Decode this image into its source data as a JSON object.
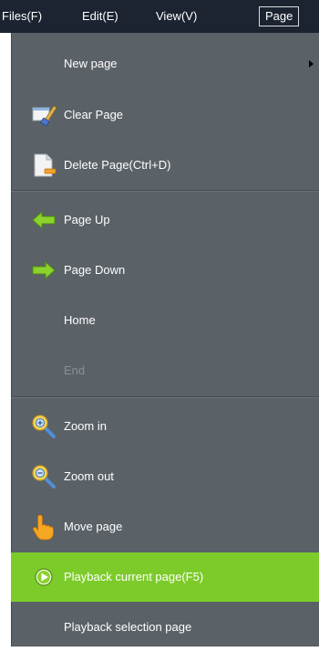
{
  "menubar": {
    "items": [
      {
        "label": "Files(F)"
      },
      {
        "label": "Edit(E)"
      },
      {
        "label": "View(V)"
      },
      {
        "label": "Page",
        "active": true
      }
    ]
  },
  "dropdown": {
    "items": [
      {
        "label": "New page",
        "icon": null,
        "submenu": true
      },
      {
        "label": "Clear Page",
        "icon": "broom-icon"
      },
      {
        "label": "Delete Page(Ctrl+D)",
        "icon": "document-delete-icon"
      },
      {
        "label": "Page Up",
        "icon": "arrow-left-green-icon"
      },
      {
        "label": "Page Down",
        "icon": "arrow-right-green-icon"
      },
      {
        "label": "Home",
        "icon": null
      },
      {
        "label": "End",
        "icon": null,
        "disabled": true
      },
      {
        "label": "Zoom in",
        "icon": "zoom-in-icon"
      },
      {
        "label": "Zoom out",
        "icon": "zoom-out-icon"
      },
      {
        "label": "Move page",
        "icon": "hand-pointer-icon"
      },
      {
        "label": "Playback current page(F5)",
        "icon": "play-circle-icon",
        "highlighted": true
      },
      {
        "label": "Playback selection page",
        "icon": null
      }
    ]
  },
  "colors": {
    "menubar_bg": "#1b2430",
    "menu_bg": "#5a6167",
    "highlight": "#7dcb2a",
    "disabled_text": "#8b9094"
  }
}
